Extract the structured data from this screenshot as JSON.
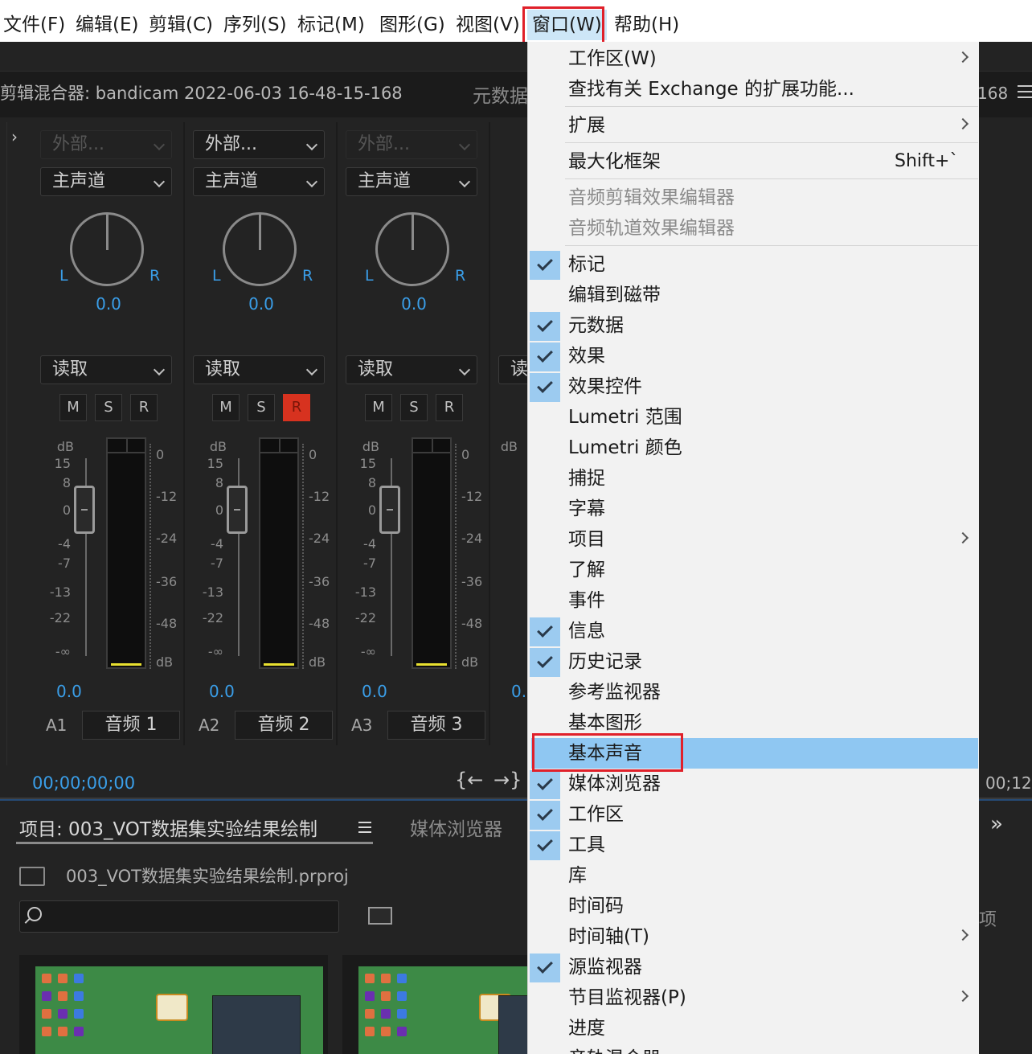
{
  "menubar": {
    "items": [
      {
        "label": "文件(F)"
      },
      {
        "label": "编辑(E)"
      },
      {
        "label": "剪辑(C)"
      },
      {
        "label": "序列(S)"
      },
      {
        "label": "标记(M)"
      },
      {
        "label": "图形(G)"
      },
      {
        "label": "视图(V)"
      },
      {
        "label": "窗口(W)"
      },
      {
        "label": "帮助(H)"
      }
    ]
  },
  "mixer": {
    "title": "剪辑混合器: bandicam 2022-06-03 16-48-15-168",
    "metadata_tab": "元数据",
    "right_fragment": "168",
    "channels": [
      {
        "input": "外部...",
        "mode": "主声道",
        "pan_l": "L",
        "pan_r": "R",
        "pan_value": "0.0",
        "automation": "读取",
        "m": "M",
        "s": "S",
        "r": "R",
        "volume": "0.0",
        "track_id": "A1",
        "track_name": "音频 1"
      },
      {
        "input": "外部...",
        "mode": "主声道",
        "pan_l": "L",
        "pan_r": "R",
        "pan_value": "0.0",
        "automation": "读取",
        "m": "M",
        "s": "S",
        "r": "R",
        "volume": "0.0",
        "track_id": "A2",
        "track_name": "音频 2"
      },
      {
        "input": "外部...",
        "mode": "主声道",
        "pan_l": "L",
        "pan_r": "R",
        "pan_value": "0.0",
        "automation": "读取",
        "m": "M",
        "s": "S",
        "r": "R",
        "volume": "0.0",
        "track_id": "A3",
        "track_name": "音频 3"
      }
    ],
    "partial_channel": {
      "automation": "读",
      "db": "dB",
      "volume": "0."
    },
    "fader_scale": {
      "unit": "dB",
      "marks": [
        "15",
        "8",
        "0",
        "-4",
        "-7",
        "-13",
        "-22",
        "-∞"
      ]
    },
    "meter_scale": {
      "marks": [
        "0",
        "-12",
        "-24",
        "-36",
        "-48",
        "dB"
      ]
    },
    "timecode_left": "00;00;00;00",
    "timecode_right": "00;12;",
    "nav_left": "{←",
    "nav_right": "→}"
  },
  "project": {
    "tab_label": "项目: 003_VOT数据集实验结果绘制",
    "media_browser_tab": "媒体浏览器",
    "more": "»",
    "path": "003_VOT数据集实验结果绘制.prproj",
    "right_fragment": "项",
    "search_placeholder": ""
  },
  "window_menu": {
    "items": [
      {
        "label": "工作区(W)",
        "submenu": true
      },
      {
        "label": "查找有关 Exchange 的扩展功能..."
      },
      {
        "label": "扩展",
        "submenu": true
      },
      {
        "label": "最大化框架",
        "shortcut": "Shift+`"
      },
      {
        "label": "音频剪辑效果编辑器",
        "disabled": true
      },
      {
        "label": "音频轨道效果编辑器",
        "disabled": true
      },
      {
        "label": "标记",
        "checked": true
      },
      {
        "label": "编辑到磁带"
      },
      {
        "label": "元数据",
        "checked": true
      },
      {
        "label": "效果",
        "checked": true
      },
      {
        "label": "效果控件",
        "checked": true
      },
      {
        "label": "Lumetri 范围"
      },
      {
        "label": "Lumetri 颜色"
      },
      {
        "label": "捕捉"
      },
      {
        "label": "字幕"
      },
      {
        "label": "项目",
        "submenu": true
      },
      {
        "label": "了解"
      },
      {
        "label": "事件"
      },
      {
        "label": "信息",
        "checked": true
      },
      {
        "label": "历史记录",
        "checked": true
      },
      {
        "label": "参考监视器"
      },
      {
        "label": "基本图形"
      },
      {
        "label": "基本声音",
        "highlighted": true
      },
      {
        "label": "媒体浏览器",
        "checked": true
      },
      {
        "label": "工作区",
        "checked": true
      },
      {
        "label": "工具",
        "checked": true
      },
      {
        "label": "库"
      },
      {
        "label": "时间码"
      },
      {
        "label": "时间轴(T)",
        "submenu": true
      },
      {
        "label": "源监视器",
        "checked": true
      },
      {
        "label": "节目监视器(P)",
        "submenu": true
      },
      {
        "label": "进度"
      },
      {
        "label": "音轨混合器"
      }
    ]
  },
  "colors": {
    "accent_blue": "#3a9ee8",
    "highlight": "#8fc7f2",
    "check_bg": "#9ccbf0",
    "annotation_red": "#e0202a",
    "record_on": "#d7321f"
  }
}
